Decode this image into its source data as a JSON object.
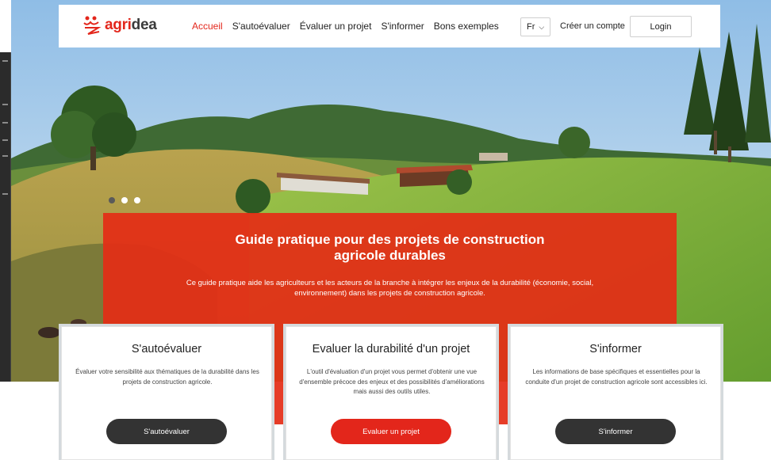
{
  "brand": {
    "logo_text_red": "agri",
    "logo_text_grey": "dea",
    "accent": "#e3261b"
  },
  "nav": {
    "items": [
      {
        "label": "Accueil",
        "active": true
      },
      {
        "label": "S'autoévaluer",
        "active": false
      },
      {
        "label": "Évaluer un projet",
        "active": false
      },
      {
        "label": "S'informer",
        "active": false
      },
      {
        "label": "Bons exemples",
        "active": false
      }
    ]
  },
  "header": {
    "language": "Fr",
    "create_account": "Créer un compte",
    "login": "Login"
  },
  "slider": {
    "slide_count": 3,
    "active_index": 0
  },
  "banner": {
    "title": "Guide pratique pour des projets de construction agricole durables",
    "text": "Ce guide pratique aide les agriculteurs et les acteurs de la branche à intégrer les enjeux de la durabilité (économie, social, environnement) dans les projets de construction agricole."
  },
  "cards": [
    {
      "title": "S'autoévaluer",
      "text": "Évaluer votre sensibilité aux thématiques de la durabilité dans les projets de construction agricole.",
      "button": "S'autoévaluer",
      "button_color": "dark"
    },
    {
      "title": "Evaluer la durabilité d'un projet",
      "text": "L'outil d'évaluation d'un projet vous permet d'obtenir une vue d'ensemble précoce des enjeux et des possibilités d'améliorations mais aussi des outils utiles.",
      "button": "Evaluer un projet",
      "button_color": "red"
    },
    {
      "title": "S'informer",
      "text": "Les informations de base spécifiques et essentielles pour la conduite d'un projet de construction agricole sont accessibles ici.",
      "button": "S'informer",
      "button_color": "dark"
    }
  ]
}
